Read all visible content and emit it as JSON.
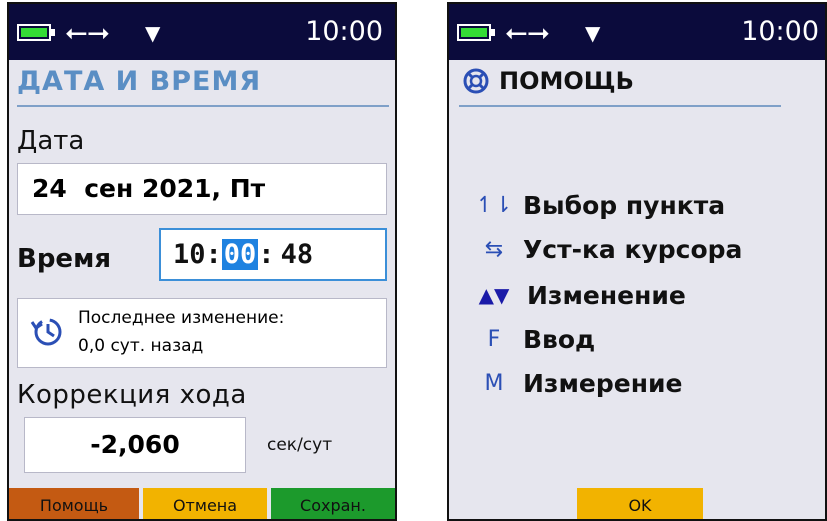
{
  "status": {
    "time": "10:00",
    "usb_icon": "usb-icon",
    "battery_icon": "battery-icon",
    "signal_icon": "dropdown-arrow-icon"
  },
  "datetime_screen": {
    "title": "ДАТА И ВРЕМЯ",
    "date_label": "Дата",
    "date_value": "24  сен 2021, Пт",
    "time_label": "Время",
    "time_hours": "10",
    "time_sep1": ":",
    "time_minutes": "00",
    "time_sep2": ":",
    "time_seconds": "48",
    "last_change_label": "Последнее изменение:",
    "last_change_value": "0,0 сут. назад",
    "correction_label": "Коррекция хода",
    "correction_value": "-2,060",
    "correction_unit": "сек/сут",
    "buttons": {
      "help": "Помощь",
      "cancel": "Отмена",
      "save": "Сохран."
    },
    "button_colors": {
      "help": "#c45a12",
      "cancel": "#f2b300",
      "save": "#1c9a2c"
    }
  },
  "help_screen": {
    "title": "ПОМОЩЬ",
    "items": [
      {
        "icon": "↿⇂",
        "text": "Выбор пункта"
      },
      {
        "icon": "⇆",
        "text": "Уст-ка курсора"
      },
      {
        "icon": "▲▼",
        "text": "Изменение"
      },
      {
        "icon": "F",
        "text": "Ввод"
      },
      {
        "icon": "M",
        "text": "Измерение"
      }
    ],
    "ok_label": "OK",
    "ok_color": "#f2b300"
  }
}
